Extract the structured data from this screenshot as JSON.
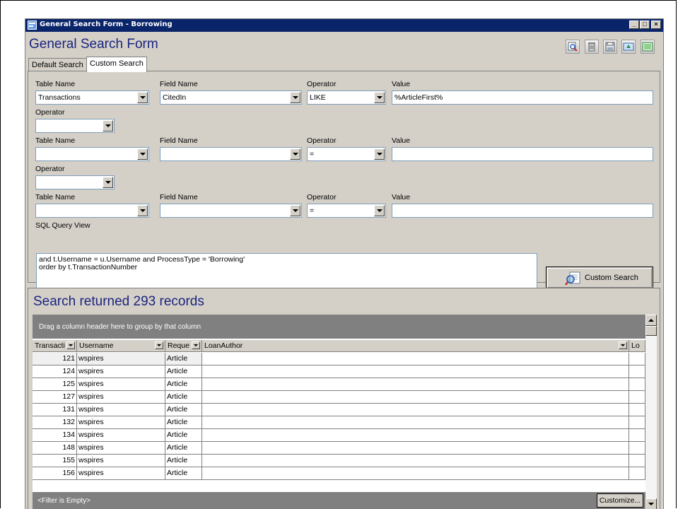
{
  "window": {
    "title": "General Search Form - Borrowing",
    "controls": [
      "minimize-icon",
      "maximize-icon",
      "close-icon"
    ]
  },
  "form_title": "General Search Form",
  "toolbar_icons": [
    "search-icon",
    "trash-icon",
    "save-icon",
    "export-icon",
    "image-icon"
  ],
  "tabs": [
    {
      "label": "Default Search",
      "active": false
    },
    {
      "label": "Custom Search",
      "active": true
    }
  ],
  "criteria": {
    "labels": {
      "table_name": "Table Name",
      "field_name": "Field Name",
      "operator": "Operator",
      "value": "Value",
      "join_operator": "Operator"
    },
    "rows": [
      {
        "table": "Transactions",
        "field": "CitedIn",
        "operator": "LIKE",
        "value": "%ArticleFirst%"
      },
      {
        "table": "",
        "field": "",
        "operator": "=",
        "value": ""
      },
      {
        "table": "",
        "field": "",
        "operator": "=",
        "value": ""
      }
    ],
    "join_operators": [
      "",
      ""
    ]
  },
  "sql": {
    "label": "SQL Query View",
    "line1": "and t.Username = u.Username and ProcessType = 'Borrowing'",
    "line2": "order by t.TransactionNumber"
  },
  "custom_search_button": "Custom Search",
  "results": {
    "title": "Search returned 293 records",
    "group_hint": "Drag a column header here to group by that column",
    "columns": [
      "Transacti",
      "Username",
      "Reque",
      "LoanAuthor",
      "Lo"
    ],
    "rows": [
      [
        "121",
        "wspires",
        "Article"
      ],
      [
        "124",
        "wspires",
        "Article"
      ],
      [
        "125",
        "wspires",
        "Article"
      ],
      [
        "127",
        "wspires",
        "Article"
      ],
      [
        "131",
        "wspires",
        "Article"
      ],
      [
        "132",
        "wspires",
        "Article"
      ],
      [
        "134",
        "wspires",
        "Article"
      ],
      [
        "148",
        "wspires",
        "Article"
      ],
      [
        "155",
        "wspires",
        "Article"
      ],
      [
        "156",
        "wspires",
        "Article"
      ]
    ],
    "filter_text": "<Filter is Empty>",
    "customize_button": "Customize..."
  }
}
